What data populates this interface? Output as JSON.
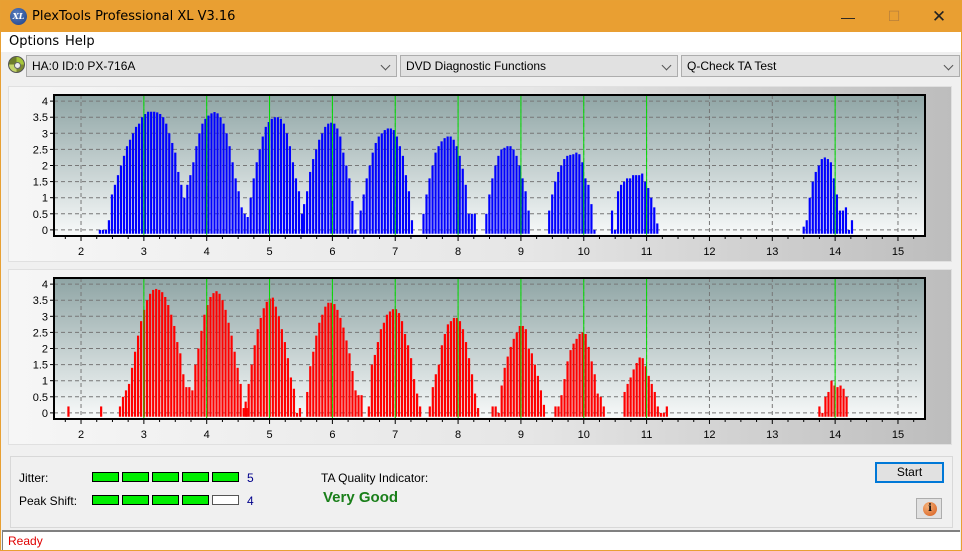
{
  "window": {
    "title": "PlexTools Professional XL V3.16",
    "app_icon_text": "XL",
    "controls": {
      "minimize": "—",
      "maximize": "☐",
      "close": "✕"
    }
  },
  "menu": {
    "items": [
      {
        "label": "Options"
      },
      {
        "label": "Help"
      }
    ]
  },
  "toolbar": {
    "drive_select": "HA:0 ID:0  PX-716A",
    "function_select": "DVD Diagnostic Functions",
    "test_select": "Q-Check TA Test"
  },
  "results": {
    "jitter_label": "Jitter:",
    "jitter_value": "5",
    "jitter_level": 5,
    "peak_shift_label": "Peak Shift:",
    "peak_shift_value": "4",
    "peak_shift_level": 4,
    "meter_max": 5,
    "ta_quality_label": "TA Quality Indicator:",
    "ta_quality_value": "Very Good",
    "start_label": "Start",
    "info_icon": "i"
  },
  "status": {
    "text": "Ready"
  },
  "colors": {
    "titlebar": "#e99f32",
    "top_bars": "#0000ff",
    "bottom_bars": "#ff0000",
    "reference_lines": "#00dd00",
    "quality_text": "#1a7f1a",
    "status_text": "#e00000"
  },
  "chart_data": [
    {
      "type": "bar",
      "name": "top-chart",
      "series_color": "#0000ff",
      "xlim": [
        1.57,
        15.43
      ],
      "ylim": [
        -0.19,
        4.19
      ],
      "x_ticks": [
        2,
        3,
        4,
        5,
        6,
        7,
        8,
        9,
        10,
        11,
        12,
        13,
        14,
        15
      ],
      "y_ticks": [
        0,
        0.5,
        1,
        1.5,
        2,
        2.5,
        3,
        3.5,
        4
      ],
      "y_tick_labels": [
        "0",
        "0.5",
        "1",
        "1.5",
        "2",
        "2.5",
        "3",
        "3.5",
        "4"
      ],
      "reference_lines": [
        3,
        4,
        5,
        6,
        7,
        8,
        9,
        10,
        11,
        14
      ],
      "grid": true,
      "bar_step": 0.048,
      "groups": [
        {
          "start": 2.3,
          "values": [
            0,
            0,
            0,
            0.3,
            1.1,
            1.4,
            1.7,
            2.0,
            2.3,
            2.6,
            2.8,
            3.0,
            3.2,
            3.3,
            3.5,
            3.6,
            3.67,
            3.67,
            3.67,
            3.65,
            3.6,
            3.5,
            3.3,
            3.0,
            2.7,
            2.4,
            1.8,
            1.4,
            1.0,
            1.4,
            1.7,
            2.1,
            2.6,
            3.0,
            3.3,
            3.45,
            3.55,
            3.62,
            3.66,
            3.62,
            3.5,
            3.3,
            3.0,
            2.6,
            2.1,
            1.6,
            1.2,
            0.7,
            0.5,
            0.4
          ]
        },
        {
          "start": 4.7,
          "values": [
            1.0,
            1.6,
            2.1,
            2.5,
            2.9,
            3.2,
            3.35,
            3.45,
            3.5,
            3.5,
            3.45,
            3.3,
            3.0,
            2.6,
            2.1,
            1.6,
            1.2,
            0.5
          ]
        },
        {
          "start": 5.55,
          "values": [
            0.8,
            1.2,
            1.8,
            2.2,
            2.5,
            2.8,
            3.0,
            3.2,
            3.3,
            3.33,
            3.3,
            3.15,
            2.9,
            2.4,
            2.0,
            1.6,
            0.9,
            0.0
          ]
        },
        {
          "start": 6.45,
          "values": [
            0.6,
            1.1,
            1.6,
            2.0,
            2.4,
            2.7,
            2.9,
            3.0,
            3.1,
            3.15,
            3.15,
            3.1,
            2.9,
            2.6,
            2.3,
            1.7,
            1.2,
            0.3
          ]
        },
        {
          "start": 7.45,
          "values": [
            0.5,
            1.1,
            1.6,
            2.0,
            2.4,
            2.6,
            2.75,
            2.85,
            2.9,
            2.9,
            2.8,
            2.6,
            2.3,
            1.9,
            1.4,
            0.5,
            0.5,
            0.5
          ]
        },
        {
          "start": 8.45,
          "values": [
            0.5,
            1.1,
            1.6,
            2.0,
            2.3,
            2.5,
            2.55,
            2.6,
            2.6,
            2.5,
            2.3,
            2.0,
            1.6,
            1.2,
            0.6
          ]
        },
        {
          "start": 9.45,
          "values": [
            0.6,
            1.1,
            1.5,
            1.8,
            2.0,
            2.2,
            2.3,
            2.33,
            2.35,
            2.4,
            2.35,
            2.1,
            1.6,
            1.4,
            0.8,
            0.0
          ]
        },
        {
          "start": 10.45,
          "values": [
            0.6,
            0.0,
            1.2,
            1.4,
            1.5,
            1.6,
            1.6,
            1.7,
            1.7,
            1.7,
            1.75,
            1.5,
            1.3,
            1.0,
            0.7,
            0.2
          ]
        },
        {
          "start": 13.5,
          "values": [
            0.1,
            0.3,
            1.0,
            1.5,
            1.8,
            2.0,
            2.2,
            2.25,
            2.2,
            2.1,
            1.6,
            1.1,
            0.6,
            0.6,
            0.7,
            0.0,
            0.3
          ]
        }
      ]
    },
    {
      "type": "bar",
      "name": "bottom-chart",
      "series_color": "#ff0000",
      "xlim": [
        1.57,
        15.43
      ],
      "ylim": [
        -0.19,
        4.19
      ],
      "x_ticks": [
        2,
        3,
        4,
        5,
        6,
        7,
        8,
        9,
        10,
        11,
        12,
        13,
        14,
        15
      ],
      "y_ticks": [
        0,
        0.5,
        1,
        1.5,
        2,
        2.5,
        3,
        3.5,
        4
      ],
      "y_tick_labels": [
        "0",
        "0.5",
        "1",
        "1.5",
        "2",
        "2.5",
        "3",
        "3.5",
        "4"
      ],
      "reference_lines": [
        3,
        4,
        5,
        6,
        7,
        8,
        9,
        10,
        11,
        14
      ],
      "grid": true,
      "bar_step": 0.048,
      "groups": [
        {
          "start": 1.8,
          "values": [
            0.2
          ]
        },
        {
          "start": 2.32,
          "values": [
            0.2
          ]
        },
        {
          "start": 2.62,
          "values": [
            0.2,
            0.5,
            0.7,
            0.9,
            1.4,
            1.9,
            2.4,
            2.85,
            3.2,
            3.5,
            3.7,
            3.82,
            3.85,
            3.82,
            3.75,
            3.6,
            3.35,
            3.05,
            2.7,
            2.2,
            1.85,
            1.2,
            0.8,
            0.8,
            0.7,
            1.5,
            2.0,
            2.55,
            3.05,
            3.35,
            3.6,
            3.72,
            3.78,
            3.7,
            3.5,
            3.2,
            2.8,
            2.4,
            1.9,
            1.4,
            0.9,
            0.15,
            0.15
          ]
        },
        {
          "start": 4.62,
          "values": [
            0.35,
            0.9,
            1.5,
            2.1,
            2.6,
            2.95,
            3.25,
            3.45,
            3.55,
            3.58,
            3.3,
            3.0,
            2.6,
            2.2,
            1.7,
            1.1,
            0.75,
            0.0,
            0.15
          ]
        },
        {
          "start": 5.6,
          "values": [
            0.65,
            1.45,
            1.9,
            2.4,
            2.8,
            3.05,
            3.3,
            3.42,
            3.42,
            3.38,
            3.2,
            2.95,
            2.65,
            2.25,
            1.85,
            1.3,
            0.7,
            0.55,
            0.55
          ]
        },
        {
          "start": 6.58,
          "values": [
            0.2,
            1.5,
            1.8,
            2.2,
            2.6,
            2.8,
            3.05,
            3.15,
            3.22,
            3.22,
            3.1,
            2.85,
            2.45,
            2.1,
            1.7,
            1.05,
            0.6,
            0.2
          ]
        },
        {
          "start": 7.55,
          "values": [
            0.2,
            0.8,
            1.2,
            1.5,
            2.1,
            2.45,
            2.75,
            2.85,
            2.95,
            2.95,
            2.85,
            2.6,
            2.2,
            1.7,
            1.2,
            0.6,
            0.15
          ]
        },
        {
          "start": 8.55,
          "values": [
            0.2,
            0.2,
            0.0,
            0.85,
            1.4,
            1.75,
            2.05,
            2.3,
            2.5,
            2.7,
            2.7,
            2.6,
            2.0,
            1.85,
            1.5,
            1.15,
            0.7,
            0.25
          ]
        },
        {
          "start": 9.55,
          "values": [
            0.2,
            0.2,
            0.55,
            1.05,
            1.6,
            1.95,
            2.15,
            2.3,
            2.45,
            2.5,
            2.45,
            2.05,
            1.6,
            1.2,
            0.6,
            0.5,
            0.2
          ]
        },
        {
          "start": 10.65,
          "values": [
            0.65,
            0.9,
            1.1,
            1.35,
            1.55,
            1.72,
            1.7,
            1.45,
            1.15,
            0.9,
            0.65,
            0.2,
            0.0,
            0.0,
            0.2
          ]
        },
        {
          "start": 13.75,
          "values": [
            0.2,
            0.0,
            0.5,
            0.65,
            1.0,
            0.85,
            0.8,
            0.85,
            0.75,
            0.5
          ]
        }
      ]
    }
  ]
}
